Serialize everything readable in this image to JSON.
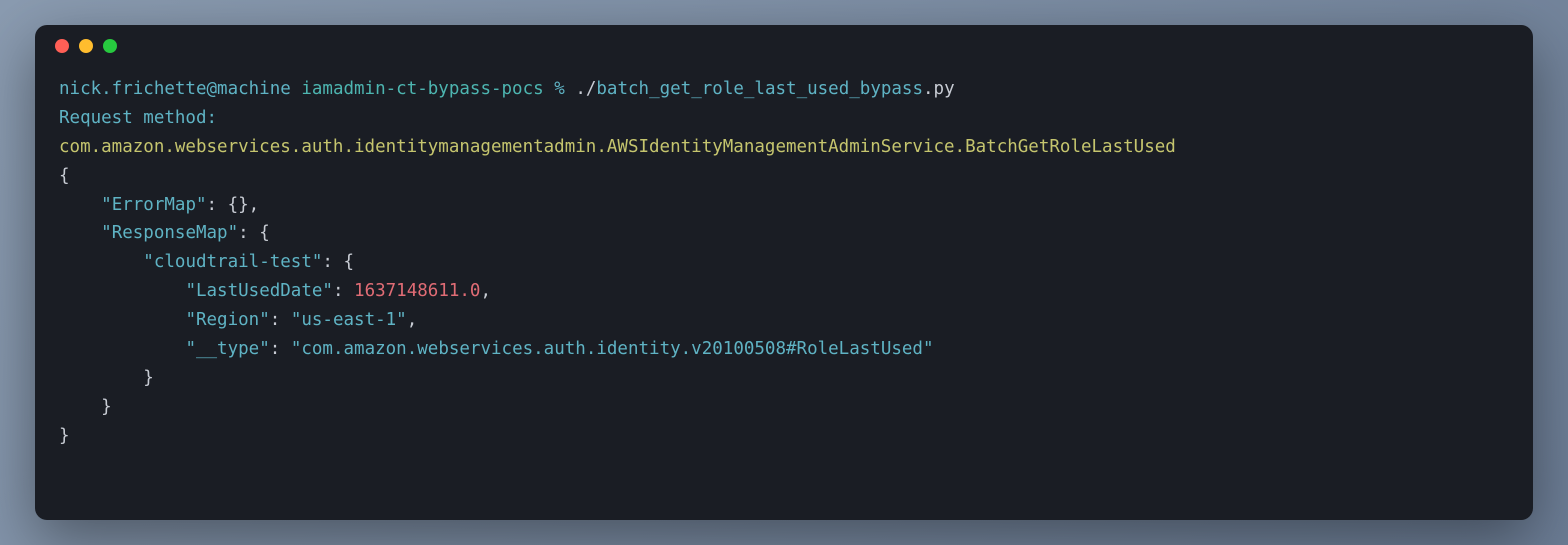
{
  "prompt": {
    "user_host": "nick.frichette@machine",
    "context": "iamadmin-ct-bypass-pocs",
    "symbol": "%",
    "cmd_prefix": "./",
    "cmd_name": "batch_get_role_last_used_bypass",
    "cmd_ext": ".py"
  },
  "output": {
    "label": "Request method:",
    "method": "com.amazon.webservices.auth.identitymanagementadmin.AWSIdentityManagementAdminService.BatchGetRoleLastUsed",
    "json": {
      "open": "{",
      "close": "}",
      "errormap_key": "\"ErrorMap\"",
      "errormap_val": "{}",
      "responsemap_key": "\"ResponseMap\"",
      "ct_key": "\"cloudtrail-test\"",
      "lastused_key": "\"LastUsedDate\"",
      "lastused_val": "1637148611.0",
      "region_key": "\"Region\"",
      "region_val": "\"us-east-1\"",
      "type_key": "\"__type\"",
      "type_val": "\"com.amazon.webservices.auth.identity.v20100508#RoleLastUsed\"",
      "colon": ": ",
      "comma": ",",
      "brace_open": "{",
      "brace_close": "}"
    }
  }
}
